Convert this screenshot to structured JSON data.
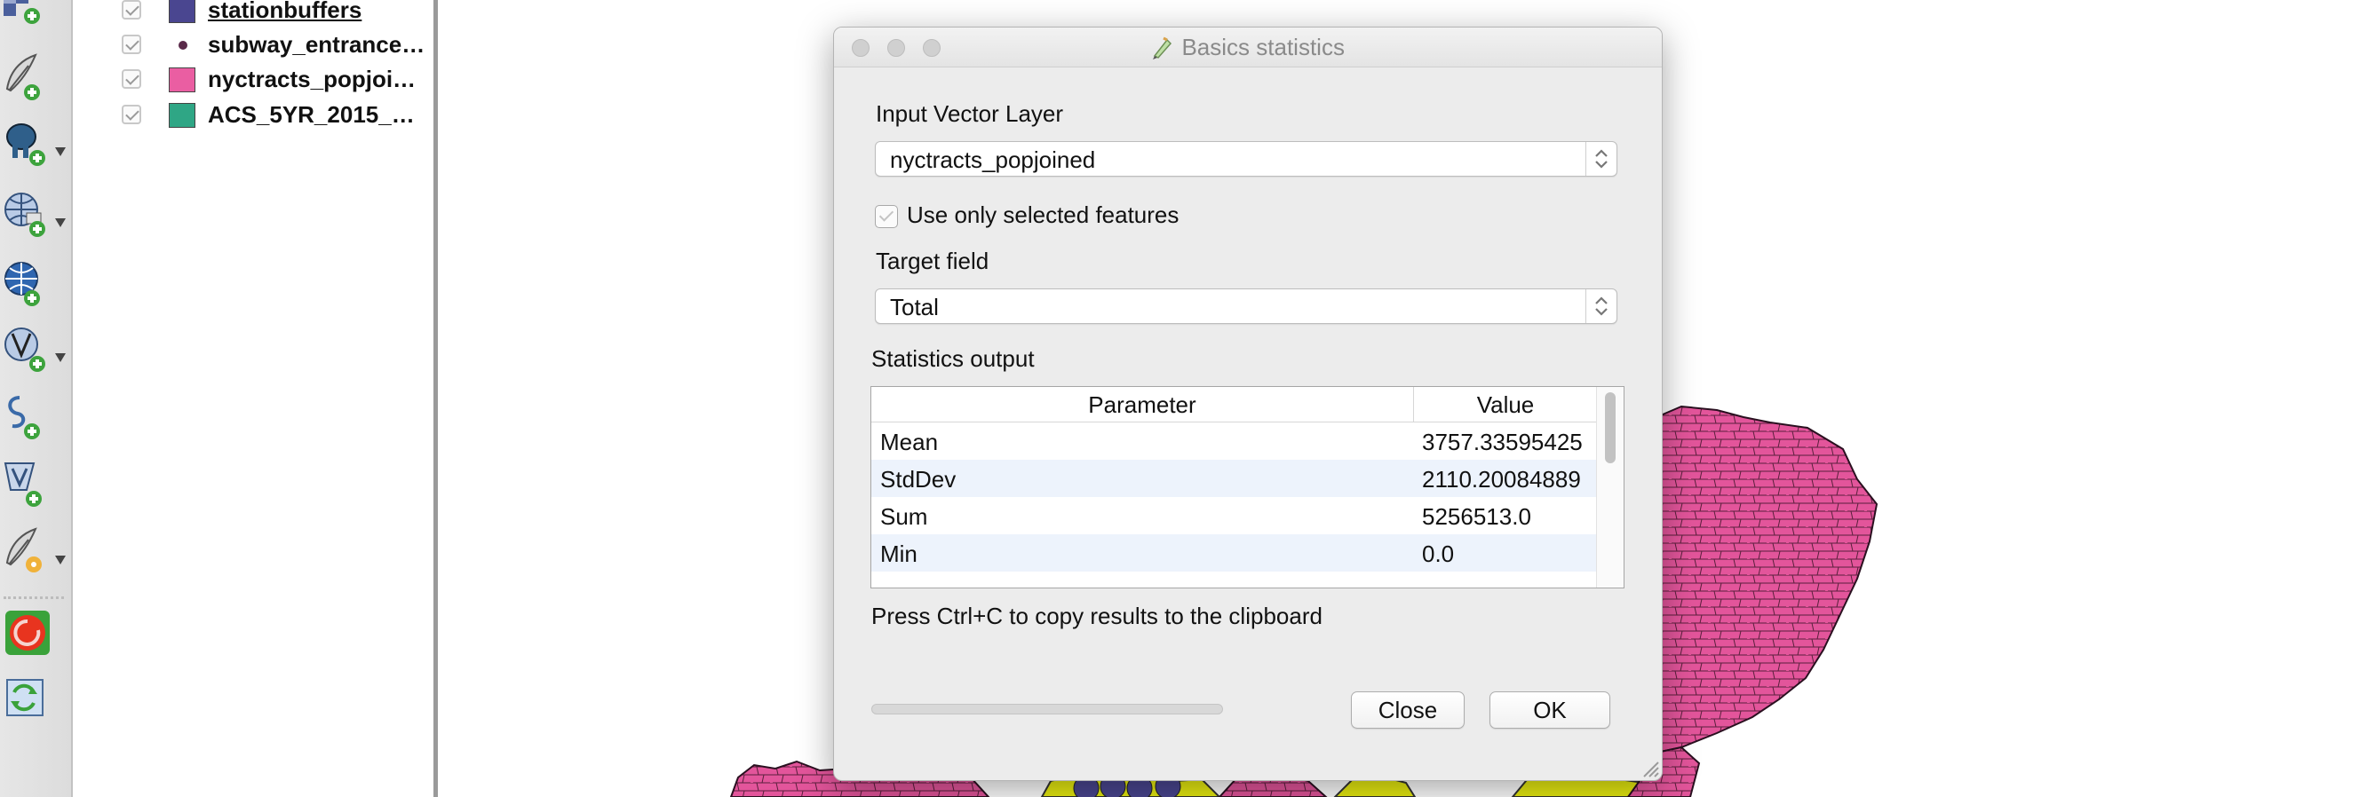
{
  "colors": {
    "accent_pink": "#e3559b",
    "accent_yellow": "#e8ec10",
    "swatch_navy": "#4a4690",
    "swatch_pink": "#ea5ea2",
    "swatch_green": "#2fa685",
    "row_alt": "#edf3fc"
  },
  "toolbar": {
    "icons": [
      "add-raster-layer-icon",
      "add-vector-layer-icon",
      "add-postgis-layer-icon",
      "add-wms-layer-icon",
      "add-wcs-layer-icon",
      "add-wfs-layer-icon",
      "add-spatialite-layer-icon",
      "add-virtual-layer-icon",
      "new-shapefile-layer-icon",
      "heatmap-plugin-icon",
      "refresh-plugin-icon"
    ]
  },
  "layers": [
    {
      "name": "stationbuffers",
      "symbol": "square",
      "color": "#4a4690",
      "checked": true
    },
    {
      "name": "subway_entrance…",
      "symbol": "dot",
      "color": "#5a2a4a",
      "checked": true
    },
    {
      "name": "nyctracts_popjoi…",
      "symbol": "square",
      "color": "#ea5ea2",
      "checked": true
    },
    {
      "name": "ACS_5YR_2015_…",
      "symbol": "square",
      "color": "#2fa685",
      "checked": true
    }
  ],
  "dialog": {
    "title": "Basics statistics",
    "input_layer_label": "Input Vector Layer",
    "input_layer_value": "nyctracts_popjoined",
    "selected_only_label": "Use only selected features",
    "selected_only_checked": false,
    "target_field_label": "Target field",
    "target_field_value": "Total",
    "stats_output_label": "Statistics output",
    "table": {
      "headers": [
        "Parameter",
        "Value"
      ],
      "rows": [
        {
          "param": "Mean",
          "value": "3757.33595425"
        },
        {
          "param": "StdDev",
          "value": "2110.20084889"
        },
        {
          "param": "Sum",
          "value": "5256513.0"
        },
        {
          "param": "Min",
          "value": "0.0"
        }
      ]
    },
    "clipboard_note": "Press Ctrl+C to copy results to the clipboard",
    "progress": 0,
    "close_label": "Close",
    "ok_label": "OK"
  }
}
